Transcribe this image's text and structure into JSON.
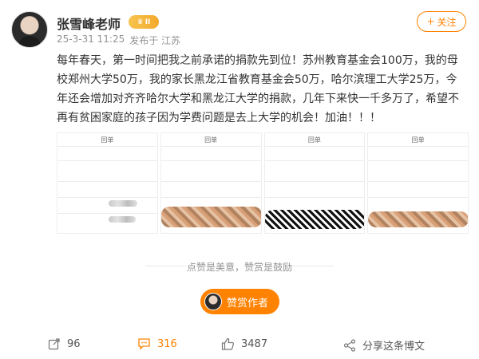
{
  "post": {
    "author_name": "张雪峰老师",
    "vip_badge": "II",
    "timestamp": "25-3-31 11:25",
    "source": "发布于 江苏",
    "follow_label": "关注",
    "content": "每年春天，第一时间把我之前承诺的捐款先到位！苏州教育基金会100万，我的母校郑州大学50万，我的家长黑龙江省教育基金会50万，哈尔滨理工大学25万，今年还会增加对齐齐哈尔大学和黑龙江大学的捐款，几年下来快一千多万了，希望不再有贫困家庭的孩子因为学费问题是去上大学的机会！加油！！！"
  },
  "images": [
    {
      "title": "回单"
    },
    {
      "title": "回单"
    },
    {
      "title": "回单"
    },
    {
      "title": "回单"
    }
  ],
  "praise_text": "点赞是美意，赞赏是鼓励",
  "tip_button": "赞赏作者",
  "actions": {
    "share_count": "96",
    "comment_count": "316",
    "like_count": "3487",
    "share_feed_label": "分享这条博文"
  },
  "colors": {
    "accent": "#ff8200",
    "meta_text": "#939393"
  }
}
